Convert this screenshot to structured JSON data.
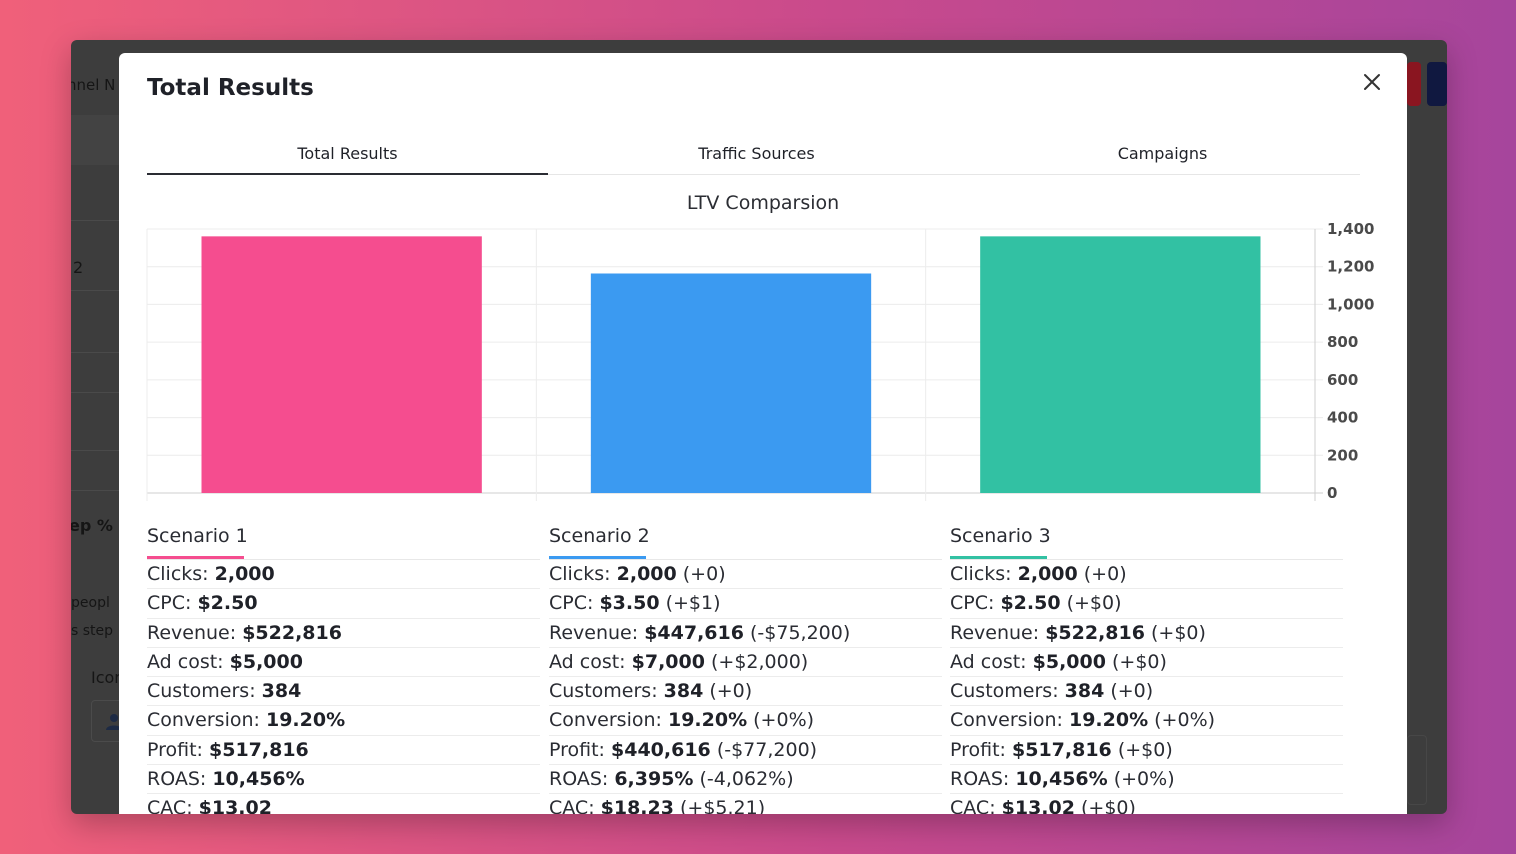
{
  "background": {
    "fragments": {
      "top_label": "nnel N",
      "num": "2",
      "step_pct": "ep %",
      "people": "peopl",
      "steps": "s step",
      "icon_label": "Icon"
    },
    "colors": {
      "window": "#3d3d3d",
      "btn_red": "#8a1520",
      "btn_navy": "#101840"
    }
  },
  "modal": {
    "title": "Total Results",
    "close_icon": "close-icon",
    "tabs": [
      {
        "label": "Total Results",
        "active": true
      },
      {
        "label": "Traffic Sources",
        "active": false
      },
      {
        "label": "Campaigns",
        "active": false
      }
    ]
  },
  "chart_data": {
    "type": "bar",
    "title": "LTV Comparsion",
    "categories": [
      "Scenario 1",
      "Scenario 2",
      "Scenario 3"
    ],
    "values": [
      1361,
      1164,
      1361
    ],
    "colors": [
      "#f54d8f",
      "#3b9af1",
      "#32c1a3"
    ],
    "ylim": [
      0,
      1400
    ],
    "yticks": [
      "1,400",
      "1,200",
      "1,000",
      "800",
      "600",
      "400",
      "200",
      "0"
    ],
    "yaxis_side": "right",
    "grid": true
  },
  "scenarios": [
    {
      "name": "Scenario 1",
      "accent": "#f54d8f",
      "metrics": [
        {
          "label": "Clicks:",
          "value": "2,000",
          "delta": ""
        },
        {
          "label": "CPC:",
          "value": "$2.50",
          "delta": ""
        },
        {
          "label": "Revenue:",
          "value": "$522,816",
          "delta": ""
        },
        {
          "label": "Ad cost:",
          "value": "$5,000",
          "delta": ""
        },
        {
          "label": "Customers:",
          "value": "384",
          "delta": ""
        },
        {
          "label": "Conversion:",
          "value": "19.20%",
          "delta": ""
        },
        {
          "label": "Profit:",
          "value": "$517,816",
          "delta": ""
        },
        {
          "label": "ROAS:",
          "value": "10,456%",
          "delta": ""
        },
        {
          "label": "CAC:",
          "value": "$13.02",
          "delta": ""
        }
      ]
    },
    {
      "name": "Scenario 2",
      "accent": "#3b9af1",
      "metrics": [
        {
          "label": "Clicks:",
          "value": "2,000",
          "delta": "(+0)"
        },
        {
          "label": "CPC:",
          "value": "$3.50",
          "delta": "(+$1)"
        },
        {
          "label": "Revenue:",
          "value": "$447,616",
          "delta": "(-$75,200)"
        },
        {
          "label": "Ad cost:",
          "value": "$7,000",
          "delta": "(+$2,000)"
        },
        {
          "label": "Customers:",
          "value": "384",
          "delta": "(+0)"
        },
        {
          "label": "Conversion:",
          "value": "19.20%",
          "delta": "(+0%)"
        },
        {
          "label": "Profit:",
          "value": "$440,616",
          "delta": "(-$77,200)"
        },
        {
          "label": "ROAS:",
          "value": "6,395%",
          "delta": "(-4,062%)"
        },
        {
          "label": "CAC:",
          "value": "$18.23",
          "delta": "(+$5.21)"
        }
      ]
    },
    {
      "name": "Scenario 3",
      "accent": "#32c1a3",
      "metrics": [
        {
          "label": "Clicks:",
          "value": "2,000",
          "delta": "(+0)"
        },
        {
          "label": "CPC:",
          "value": "$2.50",
          "delta": "(+$0)"
        },
        {
          "label": "Revenue:",
          "value": "$522,816",
          "delta": "(+$0)"
        },
        {
          "label": "Ad cost:",
          "value": "$5,000",
          "delta": "(+$0)"
        },
        {
          "label": "Customers:",
          "value": "384",
          "delta": "(+0)"
        },
        {
          "label": "Conversion:",
          "value": "19.20%",
          "delta": "(+0%)"
        },
        {
          "label": "Profit:",
          "value": "$517,816",
          "delta": "(+$0)"
        },
        {
          "label": "ROAS:",
          "value": "10,456%",
          "delta": "(+0%)"
        },
        {
          "label": "CAC:",
          "value": "$13.02",
          "delta": "(+$0)"
        }
      ]
    }
  ]
}
